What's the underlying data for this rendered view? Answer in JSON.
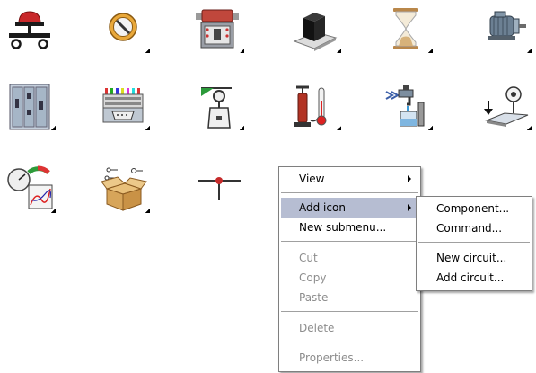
{
  "icons": [
    {
      "name": "emergency-stop-icon",
      "shortcut": false
    },
    {
      "name": "prohibition-sign-icon",
      "shortcut": true
    },
    {
      "name": "relay-module-icon",
      "shortcut": true
    },
    {
      "name": "black-cube-icon",
      "shortcut": true
    },
    {
      "name": "hourglass-icon",
      "shortcut": true
    },
    {
      "name": "electric-motor-icon",
      "shortcut": true
    },
    {
      "name": "switchgear-cabinet-icon",
      "shortcut": true
    },
    {
      "name": "terminal-strip-icon",
      "shortcut": true
    },
    {
      "name": "hoist-scale-icon",
      "shortcut": true
    },
    {
      "name": "pump-thermometer-icon",
      "shortcut": true
    },
    {
      "name": "faucet-tank-icon",
      "shortcut": true
    },
    {
      "name": "sensor-pedal-icon",
      "shortcut": true
    },
    {
      "name": "gauges-icon",
      "shortcut": true
    },
    {
      "name": "components-box-icon",
      "shortcut": true
    },
    {
      "name": "junction-icon",
      "shortcut": false
    }
  ],
  "context_menu": {
    "view": "View",
    "add_icon": "Add icon",
    "new_submenu": "New submenu...",
    "cut": "Cut",
    "copy": "Copy",
    "paste": "Paste",
    "delete": "Delete",
    "properties": "Properties..."
  },
  "submenu": {
    "component": "Component...",
    "command": "Command...",
    "new_circuit": "New circuit...",
    "add_circuit": "Add circuit..."
  },
  "colors": {
    "menu_highlight": "#b6bdd2",
    "disabled_text": "#8d8d8d"
  }
}
